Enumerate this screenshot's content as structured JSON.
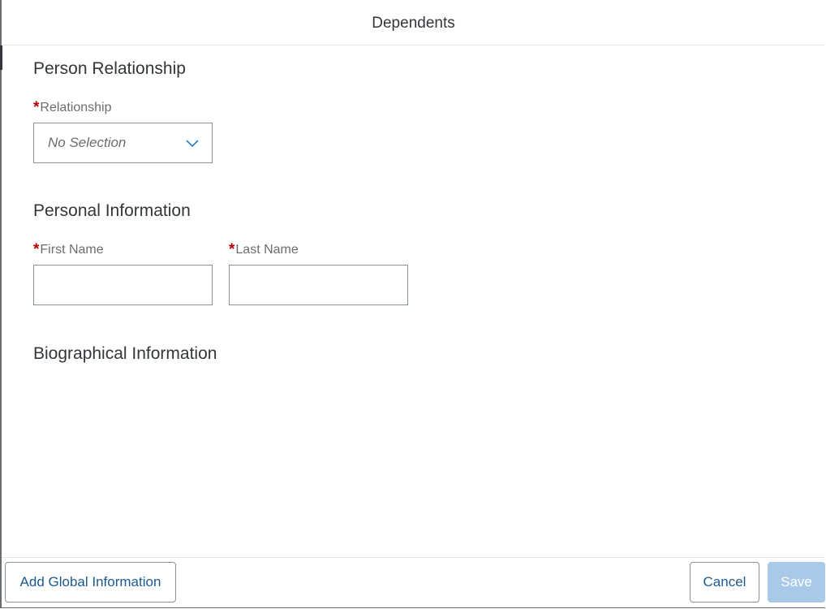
{
  "dialog": {
    "title": "Dependents"
  },
  "sections": {
    "person_relationship": {
      "title": "Person Relationship",
      "relationship": {
        "label": "Relationship",
        "required_marker": "*",
        "value": "No Selection"
      }
    },
    "personal_information": {
      "title": "Personal Information",
      "first_name": {
        "label": "First Name",
        "required_marker": "*",
        "value": ""
      },
      "last_name": {
        "label": "Last Name",
        "required_marker": "*",
        "value": ""
      }
    },
    "biographical_information": {
      "title": "Biographical Information"
    }
  },
  "footer": {
    "add_global_label": "Add Global Information",
    "cancel_label": "Cancel",
    "save_label": "Save"
  },
  "icons": {
    "relationship_dropdown": "chevron-down-icon"
  },
  "colors": {
    "required": "#bb0000",
    "accent": "#0a6ed1",
    "save_disabled": "#a9c9e8"
  }
}
